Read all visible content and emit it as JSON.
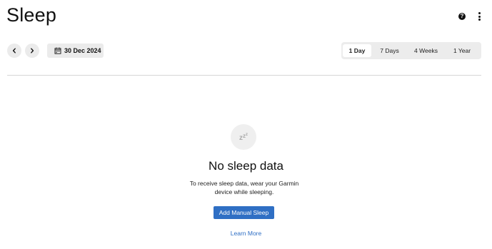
{
  "header": {
    "title": "Sleep",
    "help_icon": "question-circle-icon",
    "more_icon": "vertical-ellipsis-icon"
  },
  "toolbar": {
    "prev_icon": "chevron-left-icon",
    "next_icon": "chevron-right-icon",
    "calendar_icon": "calendar-icon",
    "date": "30 Dec 2024",
    "ranges": [
      {
        "label": "1 Day",
        "active": true
      },
      {
        "label": "7 Days",
        "active": false
      },
      {
        "label": "4 Weeks",
        "active": false
      },
      {
        "label": "1 Year",
        "active": false
      }
    ]
  },
  "empty_state": {
    "icon": "zzz-sleep-icon",
    "title": "No sleep data",
    "description": "To receive sleep data, wear your Garmin device while sleeping.",
    "button_label": "Add Manual Sleep",
    "link_label": "Learn More"
  },
  "colors": {
    "accent": "#2f6fc4",
    "control_bg": "#ebebeb"
  }
}
